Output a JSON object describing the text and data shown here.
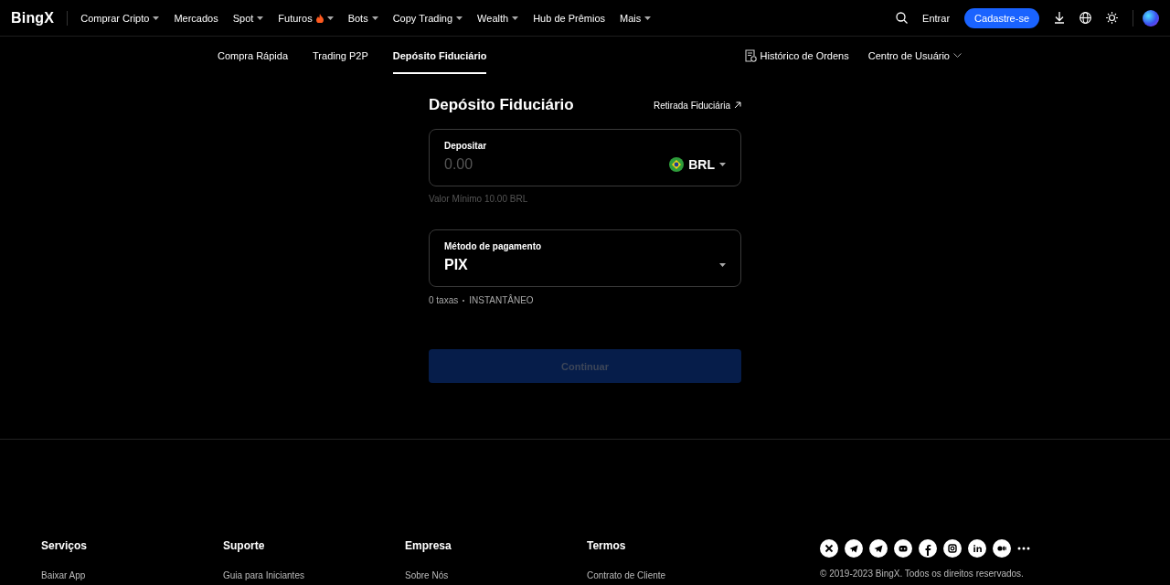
{
  "header": {
    "logo": "BingX",
    "nav": [
      {
        "label": "Comprar Cripto",
        "dropdown": true,
        "hot": false
      },
      {
        "label": "Mercados",
        "dropdown": false,
        "hot": false
      },
      {
        "label": "Spot",
        "dropdown": true,
        "hot": false
      },
      {
        "label": "Futuros",
        "dropdown": true,
        "hot": true
      },
      {
        "label": "Bots",
        "dropdown": true,
        "hot": false
      },
      {
        "label": "Copy Trading",
        "dropdown": true,
        "hot": false
      },
      {
        "label": "Wealth",
        "dropdown": true,
        "hot": false
      },
      {
        "label": "Hub de Prêmios",
        "dropdown": false,
        "hot": false
      },
      {
        "label": "Mais",
        "dropdown": true,
        "hot": false
      }
    ],
    "login": "Entrar",
    "signup": "Cadastre-se"
  },
  "subnav": {
    "tabs": [
      {
        "label": "Compra Rápida",
        "selected": false
      },
      {
        "label": "Trading P2P",
        "selected": false
      },
      {
        "label": "Depósito Fiduciário",
        "selected": true
      }
    ],
    "order_history": "Histórico de Ordens",
    "user_center": "Centro de Usuário"
  },
  "form": {
    "title": "Depósito Fiduciário",
    "withdraw_link": "Retirada Fiduciária",
    "deposit": {
      "label": "Depositar",
      "placeholder": "0.00",
      "currency": "BRL"
    },
    "minimum": "Valor Mínimo 10.00 BRL",
    "payment": {
      "label": "Método de pagamento",
      "value": "PIX"
    },
    "fees": "0 taxas",
    "speed": "INSTANTÂNEO",
    "continue": {
      "label": "Continuar",
      "disabled": true
    }
  },
  "footer": {
    "columns": [
      {
        "title": "Serviços",
        "links": [
          "Baixar App"
        ]
      },
      {
        "title": "Suporte",
        "links": [
          "Guia para Iniciantes"
        ]
      },
      {
        "title": "Empresa",
        "links": [
          "Sobre Nós"
        ]
      },
      {
        "title": "Termos",
        "links": [
          "Contrato de Cliente"
        ]
      }
    ],
    "social": [
      {
        "kind": "x"
      },
      {
        "kind": "telegram"
      },
      {
        "kind": "telegram"
      },
      {
        "kind": "discord"
      },
      {
        "kind": "facebook"
      },
      {
        "kind": "instagram"
      },
      {
        "kind": "linkedin"
      },
      {
        "kind": "medium"
      },
      {
        "kind": "more"
      }
    ],
    "copyright": "© 2019-2023 BingX. Todos os direitos reservados."
  }
}
